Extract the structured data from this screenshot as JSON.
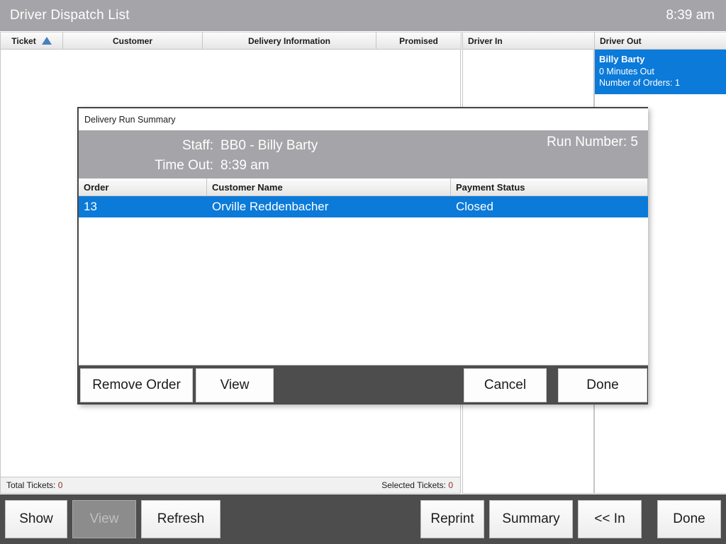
{
  "window": {
    "title": "Driver Dispatch List",
    "clock": "8:39 am"
  },
  "grid": {
    "columns": [
      {
        "label": "Ticket",
        "sort_icon": "sort-ascending-triangle-icon"
      },
      {
        "label": "Customer"
      },
      {
        "label": "Delivery Information"
      },
      {
        "label": "Promised"
      },
      {
        "label": "Driver In"
      },
      {
        "label": "Driver Out"
      }
    ],
    "rows": []
  },
  "driver_out": {
    "cards": [
      {
        "name": "Billy Barty",
        "minutes_out": "0 Minutes Out",
        "orders": "Number of Orders: 1"
      }
    ]
  },
  "statusbar": {
    "total_label": "Total Tickets:",
    "total_value": "0",
    "selected_label": "Selected Tickets:",
    "selected_value": "0"
  },
  "footer": {
    "buttons": [
      {
        "label": "Show",
        "disabled": false
      },
      {
        "label": "View",
        "disabled": true
      },
      {
        "label": "Refresh",
        "disabled": false
      },
      {
        "label": "Reprint",
        "disabled": false
      },
      {
        "label": "Summary",
        "disabled": false
      },
      {
        "label": "<<  In",
        "disabled": false
      },
      {
        "label": "Done",
        "disabled": false
      }
    ]
  },
  "dialog": {
    "title": "Delivery Run Summary",
    "staff_label": "Staff:",
    "staff_value": "BB0 - Billy Barty",
    "timeout_label": "Time Out:",
    "timeout_value": "8:39 am",
    "run_number": "Run Number: 5",
    "columns": [
      "Order",
      "Customer Name",
      "Payment Status"
    ],
    "rows": [
      {
        "order": "13",
        "customer": "Orville Reddenbacher",
        "payment": "Closed",
        "selected": true
      }
    ],
    "buttons": {
      "remove_order": "Remove Order",
      "view": "View",
      "cancel": "Cancel",
      "done": "Done"
    }
  },
  "colors": {
    "accent_blue": "#0b7ad9",
    "title_gray": "#a5a4a8",
    "toolbar_dark": "#4d4d4d",
    "sort_arrow": "#4a7ebb"
  }
}
